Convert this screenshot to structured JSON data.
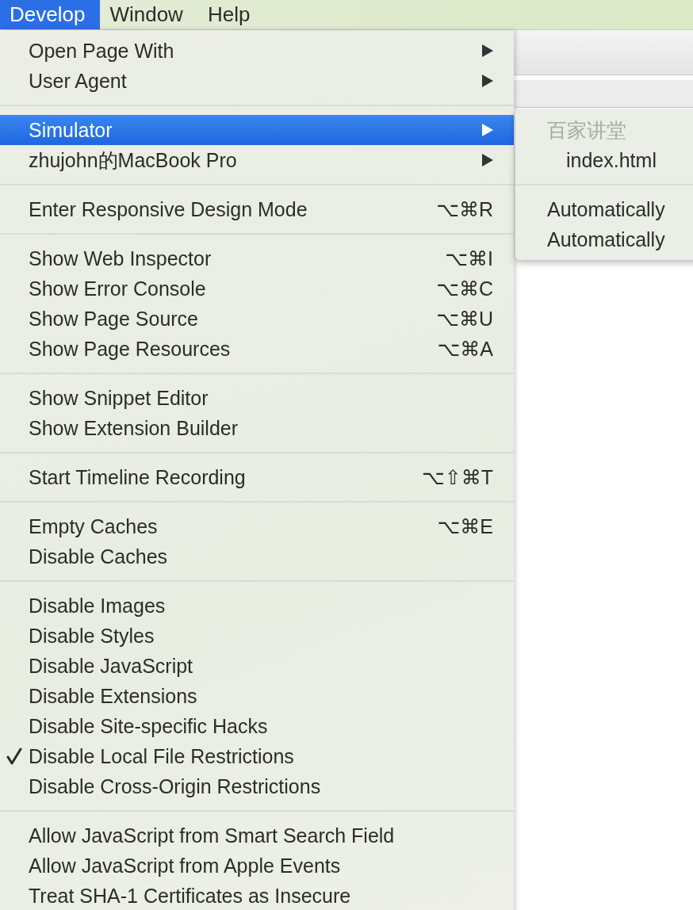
{
  "menu_bar": [
    {
      "label": "Develop",
      "selected": true
    },
    {
      "label": "Window",
      "selected": false
    },
    {
      "label": "Help",
      "selected": false
    }
  ],
  "menu": {
    "groups": [
      [
        {
          "label": "Open Page With",
          "has_submenu": true,
          "checked": false,
          "selected": false
        },
        {
          "label": "User Agent",
          "has_submenu": true,
          "checked": false,
          "selected": false
        }
      ],
      [
        {
          "label": "Simulator",
          "has_submenu": true,
          "checked": false,
          "selected": true
        },
        {
          "label": "zhujohn的MacBook Pro",
          "has_submenu": true,
          "checked": false,
          "selected": false
        }
      ],
      [
        {
          "label": "Enter Responsive Design Mode",
          "shortcut": "⌥⌘R",
          "has_submenu": false,
          "checked": false,
          "selected": false
        }
      ],
      [
        {
          "label": "Show Web Inspector",
          "shortcut": "⌥⌘I",
          "has_submenu": false,
          "checked": false,
          "selected": false
        },
        {
          "label": "Show Error Console",
          "shortcut": "⌥⌘C",
          "has_submenu": false,
          "checked": false,
          "selected": false
        },
        {
          "label": "Show Page Source",
          "shortcut": "⌥⌘U",
          "has_submenu": false,
          "checked": false,
          "selected": false
        },
        {
          "label": "Show Page Resources",
          "shortcut": "⌥⌘A",
          "has_submenu": false,
          "checked": false,
          "selected": false
        }
      ],
      [
        {
          "label": "Show Snippet Editor",
          "has_submenu": false,
          "checked": false,
          "selected": false
        },
        {
          "label": "Show Extension Builder",
          "has_submenu": false,
          "checked": false,
          "selected": false
        }
      ],
      [
        {
          "label": "Start Timeline Recording",
          "shortcut": "⌥⇧⌘T",
          "has_submenu": false,
          "checked": false,
          "selected": false
        }
      ],
      [
        {
          "label": "Empty Caches",
          "shortcut": "⌥⌘E",
          "has_submenu": false,
          "checked": false,
          "selected": false
        },
        {
          "label": "Disable Caches",
          "has_submenu": false,
          "checked": false,
          "selected": false
        }
      ],
      [
        {
          "label": "Disable Images",
          "has_submenu": false,
          "checked": false,
          "selected": false
        },
        {
          "label": "Disable Styles",
          "has_submenu": false,
          "checked": false,
          "selected": false
        },
        {
          "label": "Disable JavaScript",
          "has_submenu": false,
          "checked": false,
          "selected": false
        },
        {
          "label": "Disable Extensions",
          "has_submenu": false,
          "checked": false,
          "selected": false
        },
        {
          "label": "Disable Site-specific Hacks",
          "has_submenu": false,
          "checked": false,
          "selected": false
        },
        {
          "label": "Disable Local File Restrictions",
          "has_submenu": false,
          "checked": true,
          "selected": false
        },
        {
          "label": "Disable Cross-Origin Restrictions",
          "has_submenu": false,
          "checked": false,
          "selected": false
        }
      ],
      [
        {
          "label": "Allow JavaScript from Smart Search Field",
          "has_submenu": false,
          "checked": false,
          "selected": false
        },
        {
          "label": "Allow JavaScript from Apple Events",
          "has_submenu": false,
          "checked": false,
          "selected": false
        },
        {
          "label": "Treat SHA-1 Certificates as Insecure",
          "has_submenu": false,
          "checked": false,
          "selected": false
        }
      ]
    ]
  },
  "submenu": {
    "groups": [
      [
        {
          "label": "百家讲堂",
          "disabled": true,
          "children": [
            {
              "label": "index.html",
              "disabled": false
            }
          ]
        }
      ],
      [
        {
          "label": "Automatically",
          "disabled": false
        },
        {
          "label": "Automatically",
          "disabled": false
        }
      ]
    ]
  }
}
